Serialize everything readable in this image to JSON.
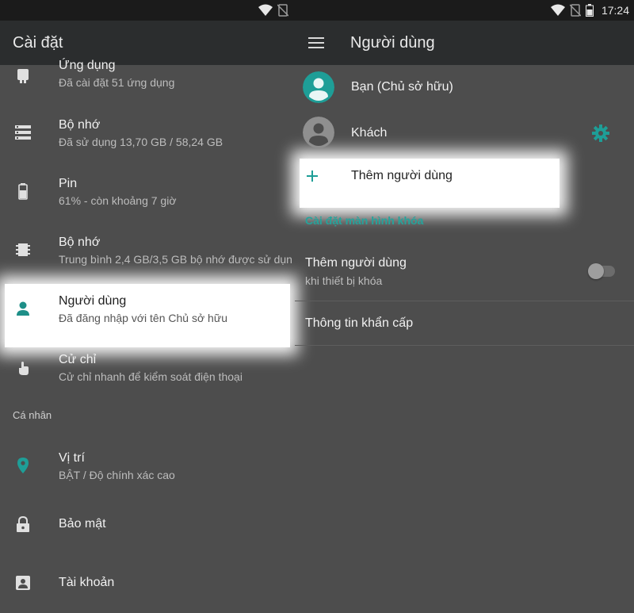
{
  "status_bar": {
    "time": "17:24"
  },
  "left_app_bar": {
    "title": "Cài đặt"
  },
  "right_app_bar": {
    "title": "Người dùng"
  },
  "settings_items": [
    {
      "icon": "android-icon",
      "title": "Ứng dụng",
      "subtitle": "Đã cài đặt 51 ứng dụng"
    },
    {
      "icon": "storage-icon",
      "title": "Bộ nhớ",
      "subtitle": "Đã sử dụng 13,70 GB / 58,24 GB"
    },
    {
      "icon": "battery-icon",
      "title": "Pin",
      "subtitle": "61% - còn khoảng 7 giờ"
    },
    {
      "icon": "memory-icon",
      "title": "Bộ nhớ",
      "subtitle": "Trung bình 2,4 GB/3,5 GB bộ nhớ được sử dụn"
    },
    {
      "icon": "person-icon",
      "title": "Người dùng",
      "subtitle": "Đã đăng nhập với tên Chủ sở hữu"
    },
    {
      "icon": "gesture-icon",
      "title": "Cử chỉ",
      "subtitle": "Cử chỉ nhanh để kiểm soát điện thoại"
    }
  ],
  "personal_section_label": "Cá nhân",
  "personal_items": [
    {
      "icon": "location-icon",
      "title": "Vị trí",
      "subtitle": "BẬT / Độ chính xác cao"
    },
    {
      "icon": "lock-icon",
      "title": "Bảo mật"
    },
    {
      "icon": "account-icon",
      "title": "Tài khoản"
    }
  ],
  "users": [
    {
      "name": "Bạn (Chủ sở hữu)",
      "avatar_color": "#1e9e97"
    },
    {
      "name": "Khách",
      "avatar_color": "#9a9a9a"
    }
  ],
  "add_user": {
    "label": "Thêm người dùng"
  },
  "lock_screen_section": "Cài đặt màn hình khóa",
  "lock_add_user": {
    "title": "Thêm người dùng",
    "subtitle": "khi thiết bị khóa",
    "toggle_on": false
  },
  "emergency_info": "Thông tin khẩn cấp",
  "colors": {
    "accent": "#1fa39a",
    "background": "#4d4d4d",
    "appbar": "#2b2d2e"
  }
}
